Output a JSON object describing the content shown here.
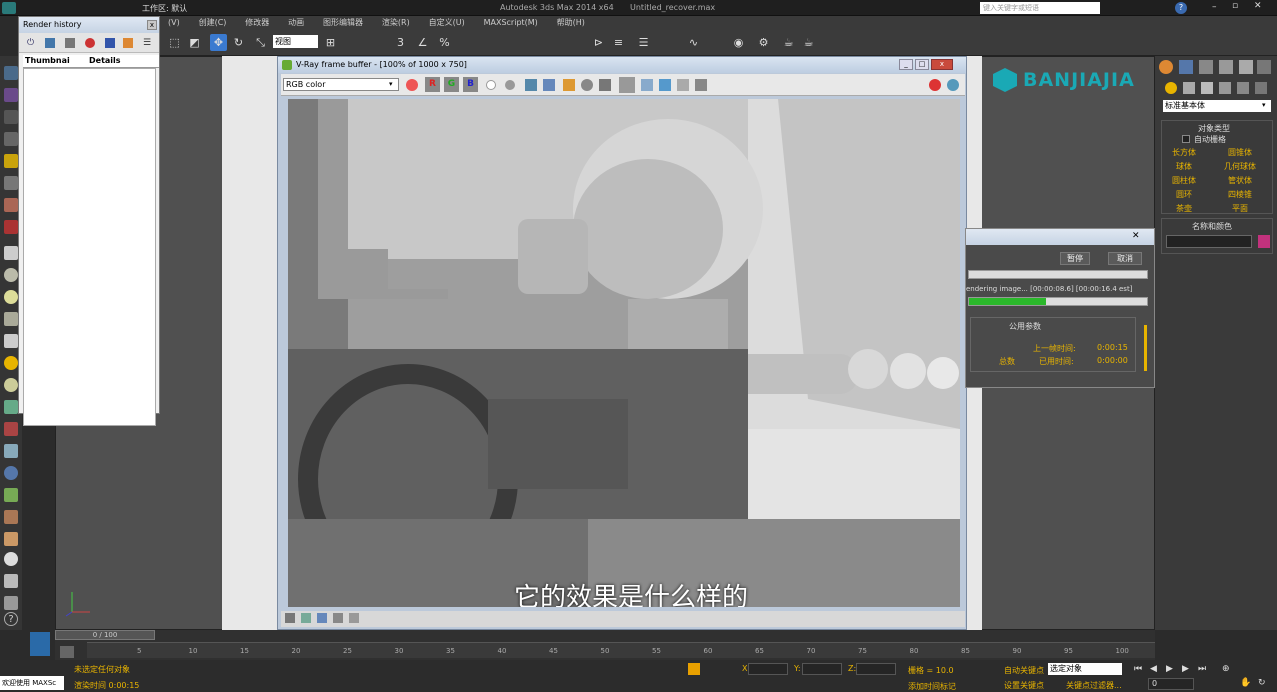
{
  "app": {
    "title": "Autodesk 3ds Max  2014 x64",
    "file": "Untitled_recover.max",
    "workspace": "工作区: 默认",
    "search_placeholder": "键入关键字或短语"
  },
  "menu": [
    "(V)",
    "创建(C)",
    "修改器",
    "动画",
    "图形编辑器",
    "渲染(R)",
    "自定义(U)",
    "MAXScript(M)",
    "帮助(H)"
  ],
  "toolbar": {
    "view_select": "视图"
  },
  "render_history": {
    "title": "Render history",
    "col_thumb": "Thumbnai",
    "col_details": "Details"
  },
  "vfb": {
    "title": "V-Ray frame buffer - [100% of 1000 x 750]",
    "channel": "RGB color",
    "r": "R",
    "g": "G",
    "b": "B"
  },
  "subtitle": "它的效果是什么样的",
  "banner": "BANJIAJIA",
  "right_panel": {
    "dropdown": "标准基本体",
    "object_type": "对象类型",
    "auto_grid": "自动栅格",
    "buttons": [
      "长方体",
      "圆锥体",
      "球体",
      "几何球体",
      "圆柱体",
      "管状体",
      "圆环",
      "四棱锥",
      "茶壶",
      "平面"
    ],
    "name_color": "名称和颜色",
    "colors": {
      "swatch": "#c2327d",
      "accent": "#e8b400"
    }
  },
  "progress_dialog": {
    "pause": "暂停",
    "cancel": "取消",
    "status": "endering image... [00:00:08.6] [00:00:16.4 est]",
    "progress": 0.43,
    "section": "公用参数",
    "last_frame_label": "上一帧时间:",
    "last_frame": "0:00:15",
    "total_label": "总数",
    "elapsed_label": "已用时间:",
    "elapsed": "0:00:00"
  },
  "timeline": {
    "frame": "0 / 100",
    "ticks": [
      "5",
      "10",
      "15",
      "20",
      "25",
      "30",
      "35",
      "40",
      "45",
      "50",
      "55",
      "60",
      "65",
      "70",
      "75",
      "80",
      "85",
      "90",
      "95",
      "100"
    ]
  },
  "status": {
    "welcome": "欢迎使用 MAXSc",
    "selection": "未选定任何对象",
    "render_time": "渲染时间 0:00:15",
    "x_label": "X:",
    "y_label": "Y:",
    "z_label": "Z:",
    "grid": "栅格 = 10.0",
    "auto_key": "自动关键点",
    "selected": "选定对象",
    "set_key": "设置关键点",
    "key_filter": "关键点过滤器...",
    "add_tag": "添加时间标记",
    "frame_field": "0"
  }
}
